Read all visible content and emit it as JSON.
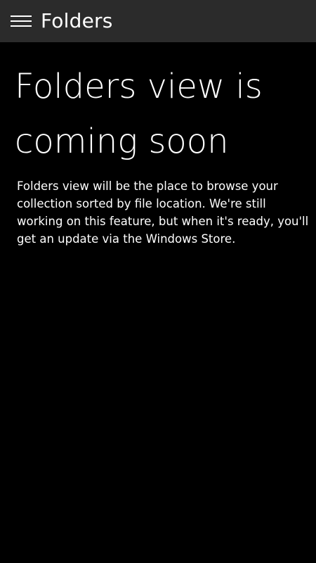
{
  "header": {
    "menu_icon": "hamburger-menu-icon",
    "title": "Folders"
  },
  "main": {
    "headline": "Folders view is coming soon",
    "description": "Folders view will be the place to browse your collection sorted by file location. We're still working on this feature, but when it's ready, you'll get an update via the Windows Store."
  },
  "colors": {
    "header_background": "#2b2b2b",
    "page_background": "#000000",
    "text": "#ffffff"
  }
}
